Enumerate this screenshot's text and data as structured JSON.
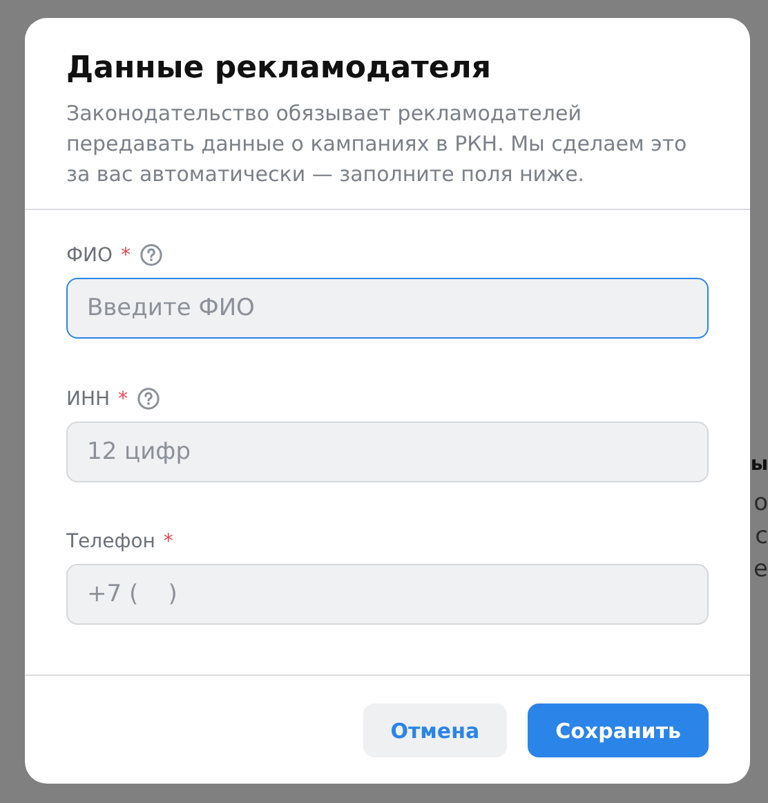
{
  "background": {
    "heading": "ы",
    "lines": [
      "о",
      "с",
      "е"
    ]
  },
  "dialog": {
    "title": "Данные рекламодателя",
    "description": "Законодательство обязывает рекламодателей передавать данные о кампаниях в РКН. Мы сделаем это за вас автоматически — заполните поля ниже.",
    "fields": [
      {
        "label": "ФИО",
        "required_mark": "*",
        "help": true,
        "placeholder": "Введите ФИО",
        "focused": true
      },
      {
        "label": "ИНН",
        "required_mark": "*",
        "help": true,
        "placeholder": "12 цифр",
        "focused": false
      },
      {
        "label": "Телефон",
        "required_mark": "*",
        "help": false,
        "placeholder": "+7 (    )",
        "focused": false
      }
    ],
    "buttons": [
      {
        "label": "Отмена",
        "kind": "secondary"
      },
      {
        "label": "Сохранить",
        "kind": "primary"
      }
    ]
  }
}
